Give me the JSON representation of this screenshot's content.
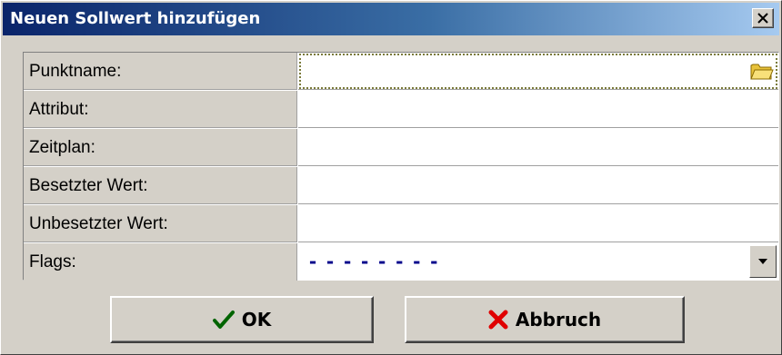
{
  "window": {
    "title": "Neuen Sollwert hinzufügen",
    "close_icon": "close-icon"
  },
  "form": {
    "rows": [
      {
        "label": "Punktname:",
        "value": "",
        "control": "folder-browse"
      },
      {
        "label": "Attribut:",
        "value": ""
      },
      {
        "label": "Zeitplan:",
        "value": ""
      },
      {
        "label": "Besetzter Wert:",
        "value": ""
      },
      {
        "label": "Unbesetzter Wert:",
        "value": ""
      },
      {
        "label": "Flags:",
        "value": "--------",
        "control": "dropdown"
      }
    ]
  },
  "buttons": {
    "ok_label": "OK",
    "cancel_label": "Abbruch"
  },
  "colors": {
    "titlebar_start": "#0a246a",
    "titlebar_end": "#a6caf0",
    "dialog_face": "#d4d0c8",
    "ok_check": "#006400",
    "cancel_x": "#e00000",
    "flags_text": "#00008b"
  }
}
